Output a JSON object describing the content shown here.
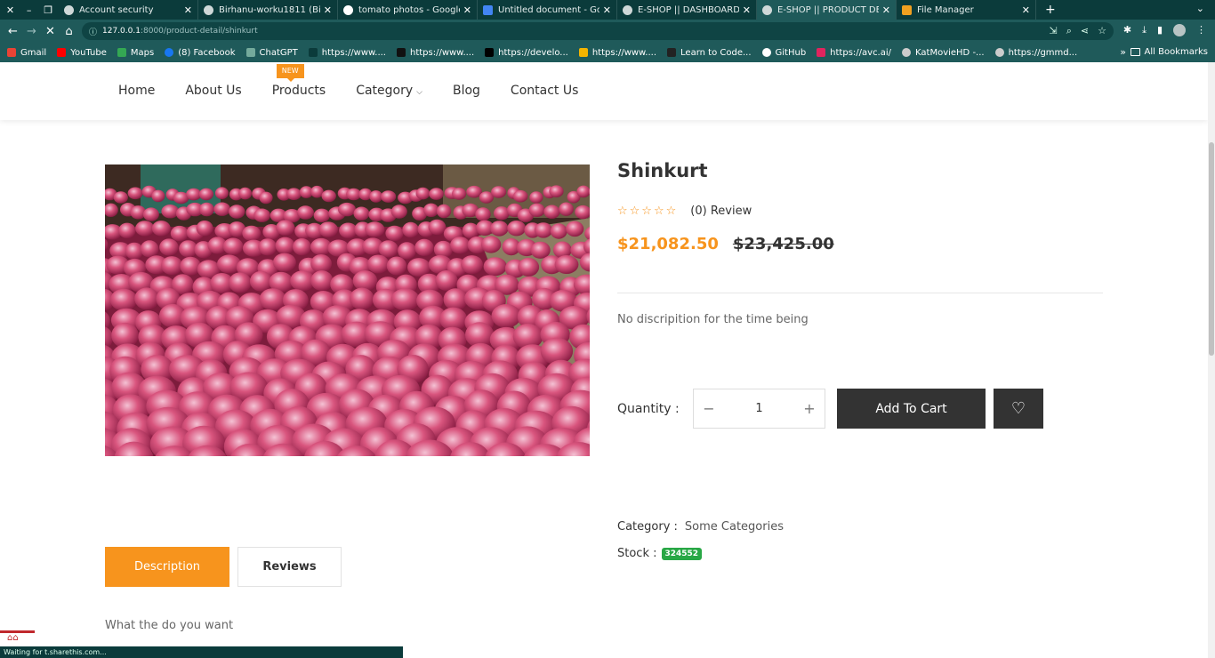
{
  "browser": {
    "tabs": [
      {
        "label": "Account security",
        "active": false
      },
      {
        "label": "Birhanu-worku1811 (Birh",
        "active": false
      },
      {
        "label": "tomato photos - Google",
        "active": false
      },
      {
        "label": "Untitled document - Goo",
        "active": false
      },
      {
        "label": "E-SHOP || DASHBOARD",
        "active": false
      },
      {
        "label": "E-SHOP || PRODUCT DETA",
        "active": true
      },
      {
        "label": "File Manager",
        "active": false
      }
    ],
    "url_host": "127.0.0.1",
    "url_rest": ":8000/product-detail/shinkurt",
    "bookmarks": [
      "Gmail",
      "YouTube",
      "Maps",
      "(8) Facebook",
      "ChatGPT",
      "https://www....",
      "https://www....",
      "https://develo...",
      "https://www....",
      "Learn to Code...",
      "GitHub",
      "https://avc.ai/",
      "KatMovieHD -...",
      "https://gmmd..."
    ],
    "all_bookmarks": "All Bookmarks",
    "status": "Waiting for t.sharethis.com..."
  },
  "nav": {
    "items": [
      "Home",
      "About Us",
      "Products",
      "Category",
      "Blog",
      "Contact Us"
    ],
    "badge": "NEW"
  },
  "product": {
    "title": "Shinkurt",
    "stars": "☆☆☆☆☆",
    "review_text": "(0) Review",
    "price_new": "$21,082.50",
    "price_old": "$23,425.00",
    "summary": "No discripition for the time being",
    "quantity_label": "Quantity :",
    "quantity": "1",
    "add_to_cart": "Add To Cart",
    "category_label": "Category :",
    "category": "Some Categories",
    "stock_label": "Stock :",
    "stock": "324552"
  },
  "tabs": {
    "description": "Description",
    "reviews": "Reviews",
    "body": "What the do you want"
  },
  "colors": {
    "accent": "#f7941d",
    "dark": "#333333",
    "stock_badge": "#28a745",
    "chrome": "#1f5a5a"
  }
}
